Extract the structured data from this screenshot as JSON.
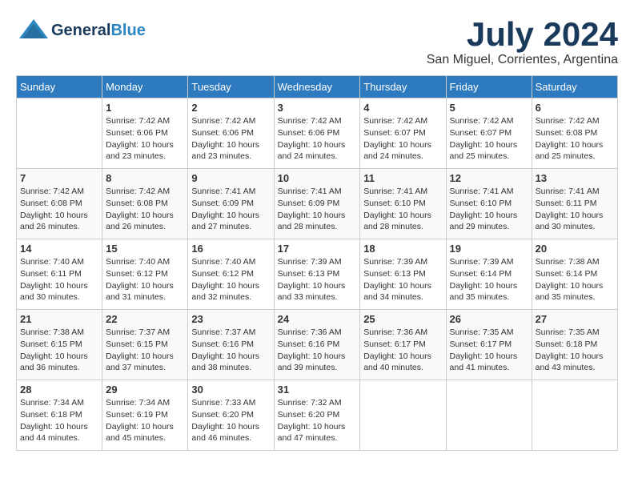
{
  "header": {
    "logo_general": "General",
    "logo_blue": "Blue",
    "month": "July 2024",
    "location": "San Miguel, Corrientes, Argentina"
  },
  "weekdays": [
    "Sunday",
    "Monday",
    "Tuesday",
    "Wednesday",
    "Thursday",
    "Friday",
    "Saturday"
  ],
  "weeks": [
    [
      {
        "day": "",
        "content": ""
      },
      {
        "day": "1",
        "content": "Sunrise: 7:42 AM\nSunset: 6:06 PM\nDaylight: 10 hours\nand 23 minutes."
      },
      {
        "day": "2",
        "content": "Sunrise: 7:42 AM\nSunset: 6:06 PM\nDaylight: 10 hours\nand 23 minutes."
      },
      {
        "day": "3",
        "content": "Sunrise: 7:42 AM\nSunset: 6:06 PM\nDaylight: 10 hours\nand 24 minutes."
      },
      {
        "day": "4",
        "content": "Sunrise: 7:42 AM\nSunset: 6:07 PM\nDaylight: 10 hours\nand 24 minutes."
      },
      {
        "day": "5",
        "content": "Sunrise: 7:42 AM\nSunset: 6:07 PM\nDaylight: 10 hours\nand 25 minutes."
      },
      {
        "day": "6",
        "content": "Sunrise: 7:42 AM\nSunset: 6:08 PM\nDaylight: 10 hours\nand 25 minutes."
      }
    ],
    [
      {
        "day": "7",
        "content": "Sunrise: 7:42 AM\nSunset: 6:08 PM\nDaylight: 10 hours\nand 26 minutes."
      },
      {
        "day": "8",
        "content": "Sunrise: 7:42 AM\nSunset: 6:08 PM\nDaylight: 10 hours\nand 26 minutes."
      },
      {
        "day": "9",
        "content": "Sunrise: 7:41 AM\nSunset: 6:09 PM\nDaylight: 10 hours\nand 27 minutes."
      },
      {
        "day": "10",
        "content": "Sunrise: 7:41 AM\nSunset: 6:09 PM\nDaylight: 10 hours\nand 28 minutes."
      },
      {
        "day": "11",
        "content": "Sunrise: 7:41 AM\nSunset: 6:10 PM\nDaylight: 10 hours\nand 28 minutes."
      },
      {
        "day": "12",
        "content": "Sunrise: 7:41 AM\nSunset: 6:10 PM\nDaylight: 10 hours\nand 29 minutes."
      },
      {
        "day": "13",
        "content": "Sunrise: 7:41 AM\nSunset: 6:11 PM\nDaylight: 10 hours\nand 30 minutes."
      }
    ],
    [
      {
        "day": "14",
        "content": "Sunrise: 7:40 AM\nSunset: 6:11 PM\nDaylight: 10 hours\nand 30 minutes."
      },
      {
        "day": "15",
        "content": "Sunrise: 7:40 AM\nSunset: 6:12 PM\nDaylight: 10 hours\nand 31 minutes."
      },
      {
        "day": "16",
        "content": "Sunrise: 7:40 AM\nSunset: 6:12 PM\nDaylight: 10 hours\nand 32 minutes."
      },
      {
        "day": "17",
        "content": "Sunrise: 7:39 AM\nSunset: 6:13 PM\nDaylight: 10 hours\nand 33 minutes."
      },
      {
        "day": "18",
        "content": "Sunrise: 7:39 AM\nSunset: 6:13 PM\nDaylight: 10 hours\nand 34 minutes."
      },
      {
        "day": "19",
        "content": "Sunrise: 7:39 AM\nSunset: 6:14 PM\nDaylight: 10 hours\nand 35 minutes."
      },
      {
        "day": "20",
        "content": "Sunrise: 7:38 AM\nSunset: 6:14 PM\nDaylight: 10 hours\nand 35 minutes."
      }
    ],
    [
      {
        "day": "21",
        "content": "Sunrise: 7:38 AM\nSunset: 6:15 PM\nDaylight: 10 hours\nand 36 minutes."
      },
      {
        "day": "22",
        "content": "Sunrise: 7:37 AM\nSunset: 6:15 PM\nDaylight: 10 hours\nand 37 minutes."
      },
      {
        "day": "23",
        "content": "Sunrise: 7:37 AM\nSunset: 6:16 PM\nDaylight: 10 hours\nand 38 minutes."
      },
      {
        "day": "24",
        "content": "Sunrise: 7:36 AM\nSunset: 6:16 PM\nDaylight: 10 hours\nand 39 minutes."
      },
      {
        "day": "25",
        "content": "Sunrise: 7:36 AM\nSunset: 6:17 PM\nDaylight: 10 hours\nand 40 minutes."
      },
      {
        "day": "26",
        "content": "Sunrise: 7:35 AM\nSunset: 6:17 PM\nDaylight: 10 hours\nand 41 minutes."
      },
      {
        "day": "27",
        "content": "Sunrise: 7:35 AM\nSunset: 6:18 PM\nDaylight: 10 hours\nand 43 minutes."
      }
    ],
    [
      {
        "day": "28",
        "content": "Sunrise: 7:34 AM\nSunset: 6:18 PM\nDaylight: 10 hours\nand 44 minutes."
      },
      {
        "day": "29",
        "content": "Sunrise: 7:34 AM\nSunset: 6:19 PM\nDaylight: 10 hours\nand 45 minutes."
      },
      {
        "day": "30",
        "content": "Sunrise: 7:33 AM\nSunset: 6:20 PM\nDaylight: 10 hours\nand 46 minutes."
      },
      {
        "day": "31",
        "content": "Sunrise: 7:32 AM\nSunset: 6:20 PM\nDaylight: 10 hours\nand 47 minutes."
      },
      {
        "day": "",
        "content": ""
      },
      {
        "day": "",
        "content": ""
      },
      {
        "day": "",
        "content": ""
      }
    ]
  ]
}
